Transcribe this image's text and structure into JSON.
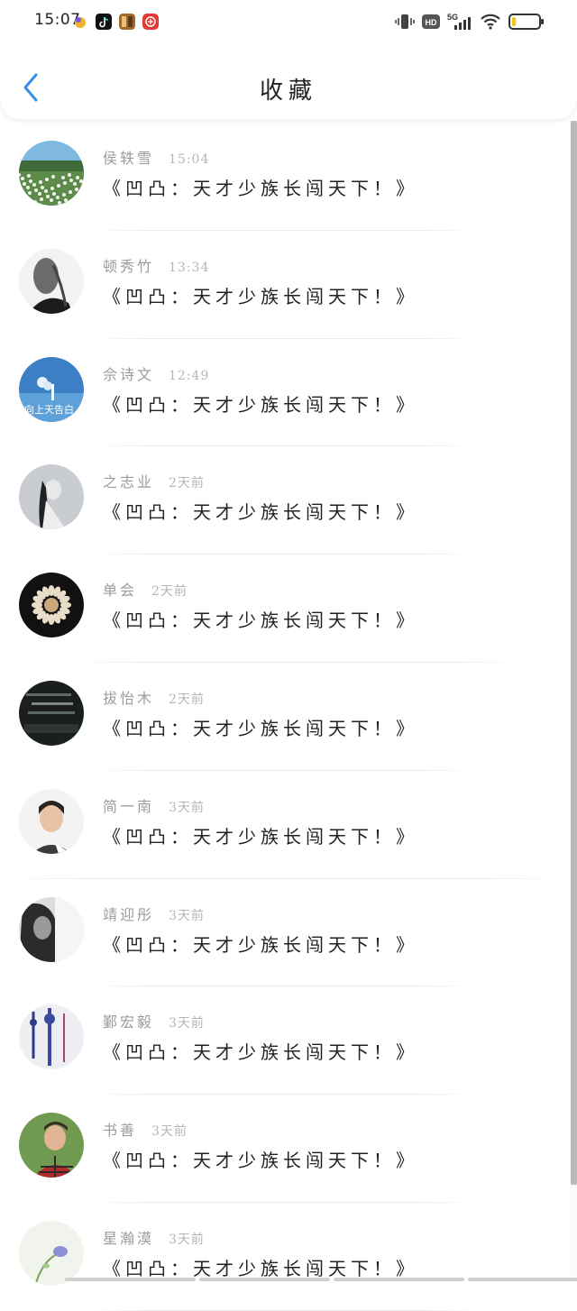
{
  "status_bar": {
    "time": "15:07",
    "network_badge": "HD",
    "network_type": "5G",
    "battery_level": 0.15,
    "apps": [
      {
        "icon": "browser-app-icon",
        "color": "#f2b32d"
      },
      {
        "icon": "tiktok-app-icon",
        "color": "#111111"
      },
      {
        "icon": "game-app-icon",
        "color": "#a06a2c"
      },
      {
        "icon": "red-app-icon",
        "color": "#e53935"
      }
    ]
  },
  "header": {
    "title": "收藏",
    "back_icon": "chevron-left-icon",
    "accent_color": "#3a8ee6"
  },
  "favorites": [
    {
      "name": "侯轶雪",
      "time": "15:04",
      "title": "《凹凸：天才少族长闯天下！》",
      "avatar": "meadow-photo"
    },
    {
      "name": "顿秀竹",
      "time": "13:34",
      "title": "《凹凸：天才少族长闯天下！》",
      "avatar": "girl-bw-photo"
    },
    {
      "name": "佘诗文",
      "time": "12:49",
      "title": "《凹凸：天才少族长闯天下！》",
      "avatar": "balloon-sky-photo"
    },
    {
      "name": "之志业",
      "time": "2天前",
      "title": "《凹凸：天才少族长闯天下！》",
      "avatar": "ink-figure-photo"
    },
    {
      "name": "单会",
      "time": "2天前",
      "title": "《凹凸：天才少族长闯天下！》",
      "avatar": "flower-dark-photo"
    },
    {
      "name": "拔怡木",
      "time": "2天前",
      "title": "《凹凸：天才少族长闯天下！》",
      "avatar": "dark-text-photo"
    },
    {
      "name": "简一南",
      "time": "3天前",
      "title": "《凹凸：天才少族长闯天下！》",
      "avatar": "woman-portrait-photo"
    },
    {
      "name": "靖迎彤",
      "time": "3天前",
      "title": "《凹凸：天才少族长闯天下！》",
      "avatar": "woman-bw-photo"
    },
    {
      "name": "鄞宏毅",
      "time": "3天前",
      "title": "《凹凸：天才少族长闯天下！》",
      "avatar": "tassels-photo"
    },
    {
      "name": "书善",
      "time": "3天前",
      "title": "《凹凸：天才少族长闯天下！》",
      "avatar": "boy-plaid-photo"
    },
    {
      "name": "星瀚漠",
      "time": "3天前",
      "title": "《凹凸：天才少族长闯天下！》",
      "avatar": "flower-light-photo"
    }
  ]
}
